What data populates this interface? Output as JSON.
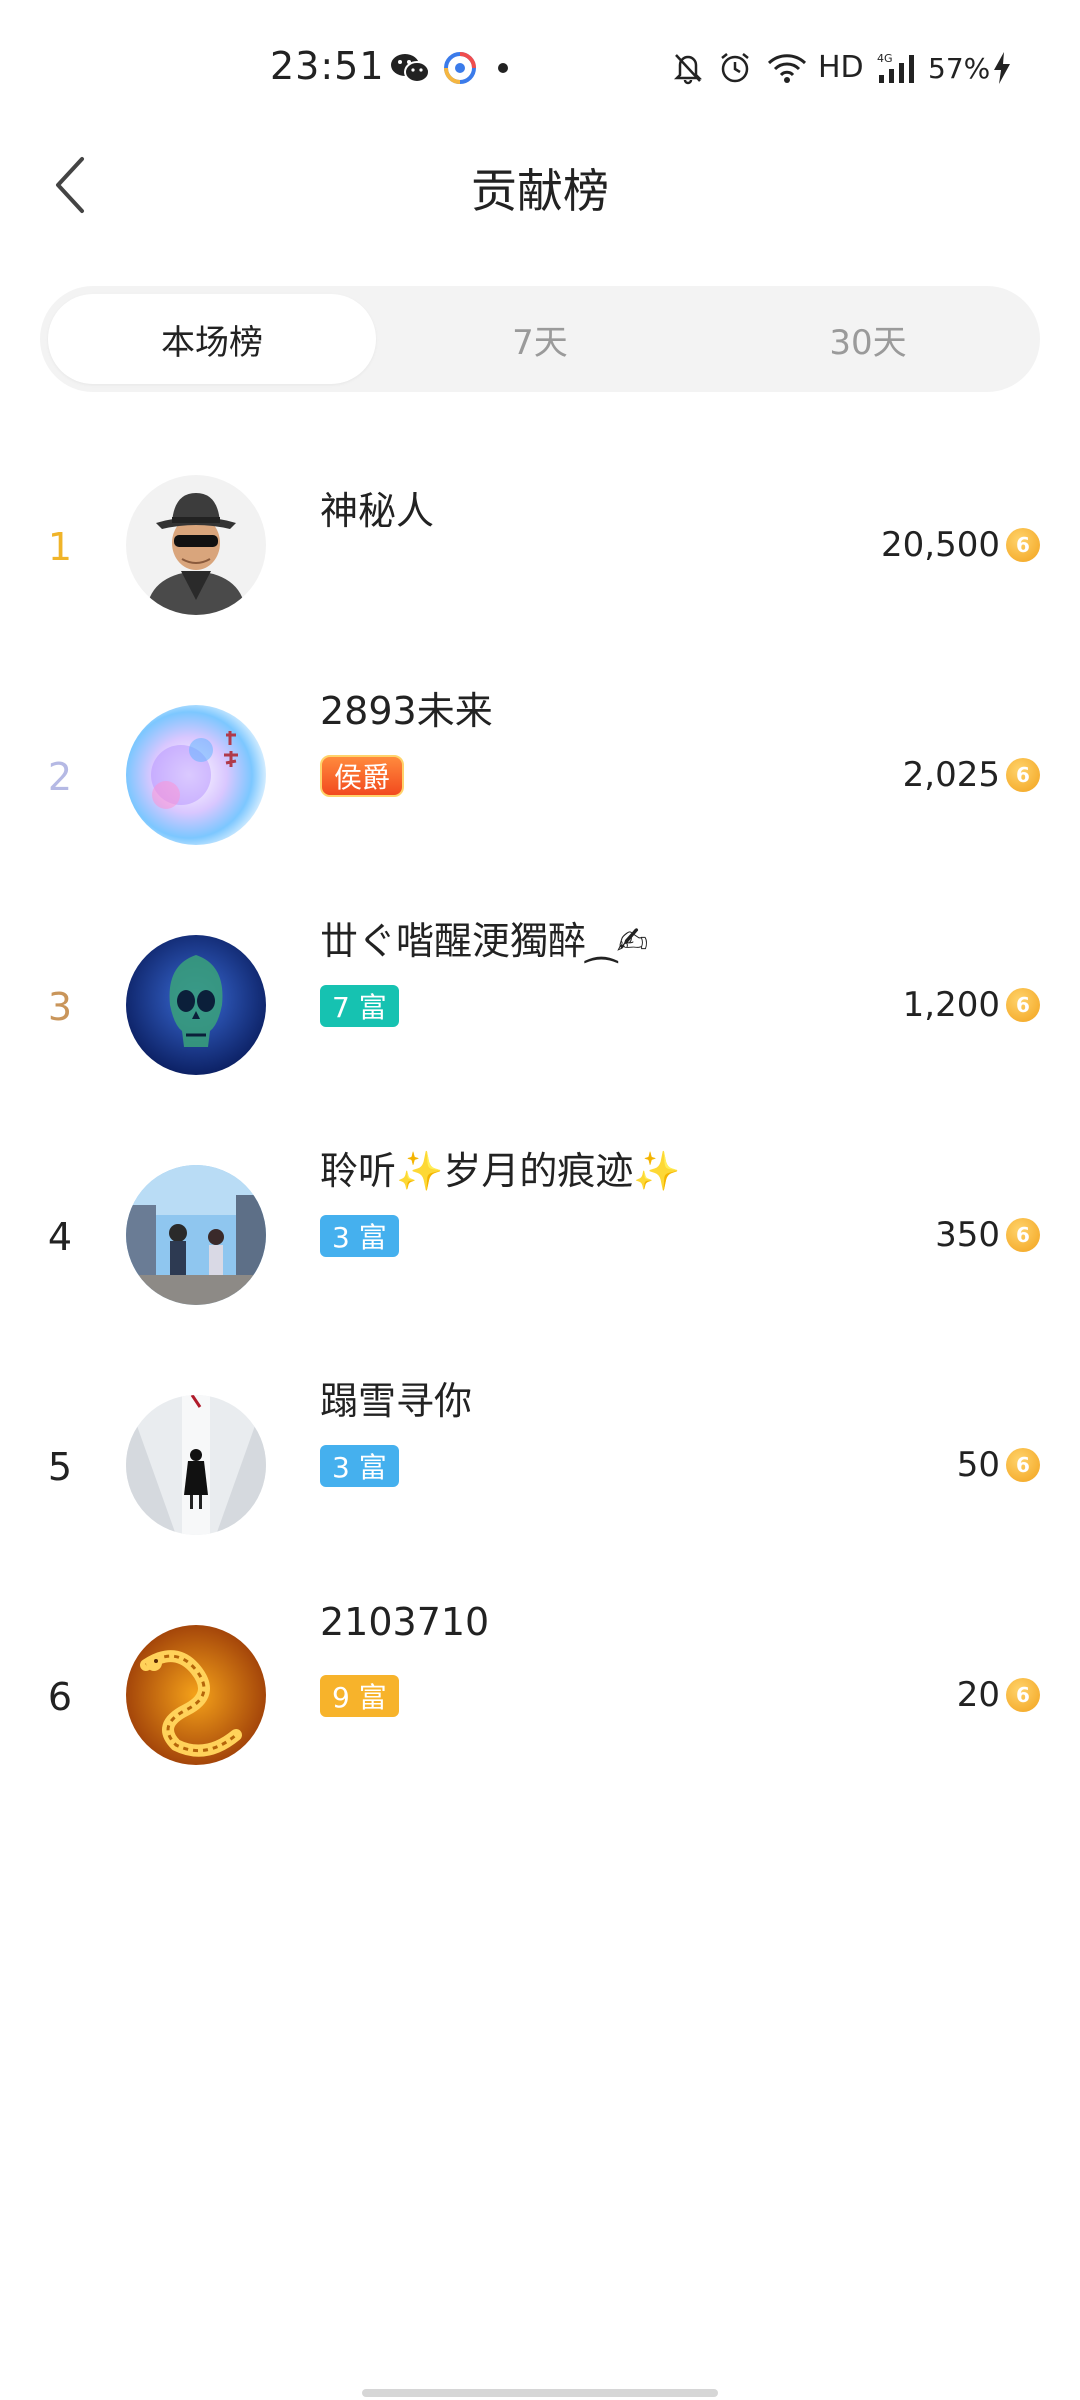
{
  "status_bar": {
    "time": "23:51",
    "hd": "HD",
    "battery": "57%",
    "icons": [
      "wechat-icon",
      "app-icon",
      "dot-icon",
      "bell-off-icon",
      "alarm-icon",
      "wifi-icon",
      "signal-4g-icon",
      "charging-bolt-icon"
    ]
  },
  "header": {
    "title": "贡献榜",
    "back_icon": "chevron-left-icon"
  },
  "tabs": [
    {
      "label": "本场榜",
      "active": true
    },
    {
      "label": "7天",
      "active": false
    },
    {
      "label": "30天",
      "active": false
    }
  ],
  "colors": {
    "rank_1": "#f0b429",
    "rank_2": "#b5b9e4",
    "rank_3": "#c9955a",
    "rank_default": "#222222",
    "badge_teal": "#16c2b1",
    "badge_blue": "#45b0ee",
    "badge_orange": "#f7b32b",
    "coin": "#f2a21d"
  },
  "entries": [
    {
      "rank": "1",
      "name": "神秘人",
      "badge": "",
      "score": "20,500"
    },
    {
      "rank": "2",
      "name": "2893未来",
      "badge": "侯爵",
      "score": "2,025"
    },
    {
      "rank": "3",
      "name": "丗ぐ喈醒浭獨醉⁔✍",
      "badge": "7 富",
      "score": "1,200"
    },
    {
      "rank": "4",
      "name": "聆听✨岁月的痕迹✨",
      "badge": "3 富",
      "score": "350"
    },
    {
      "rank": "5",
      "name": "蹋雪寻你",
      "badge": "3 富",
      "score": "50"
    },
    {
      "rank": "6",
      "name": "2103710",
      "badge": "9 富",
      "score": "20"
    }
  ],
  "coin_icon": "coin-icon",
  "coin_glyph": "6"
}
